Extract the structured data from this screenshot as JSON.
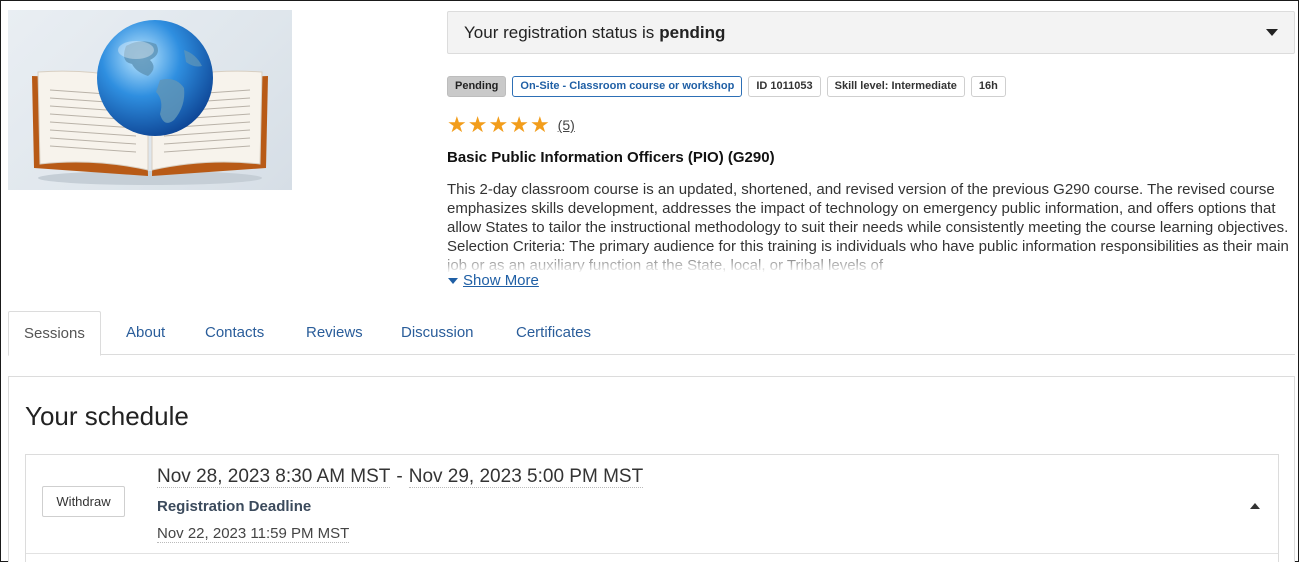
{
  "status": {
    "prefix": "Your registration status is",
    "value": "pending"
  },
  "badges": [
    "Pending",
    "On-Site - Classroom course or workshop",
    "ID 1011053",
    "Skill level: Intermediate",
    "16h"
  ],
  "rating": {
    "stars": 5,
    "count": "(5)"
  },
  "course": {
    "title": "Basic Public Information Officers (PIO) (G290)",
    "description": "This 2-day classroom course is an updated, shortened, and revised version of the previous G290 course. The revised course emphasizes skills development, addresses the impact of technology on emergency public information, and offers options that allow States to tailor the instructional methodology to suit their needs while consistently meeting the course learning objectives. Selection Criteria: The primary audience for this training is individuals who have public information responsibilities as their main job or as an auxiliary function at the State, local, or Tribal levels of",
    "show_more": "Show More"
  },
  "tabs": [
    "Sessions",
    "About",
    "Contacts",
    "Reviews",
    "Discussion",
    "Certificates"
  ],
  "schedule": {
    "title": "Your schedule",
    "session": {
      "withdraw": "Withdraw",
      "start": "Nov 28, 2023 8:30 AM MST",
      "separator": "-",
      "end": "Nov 29, 2023 5:00 PM MST",
      "deadline_label": "Registration Deadline",
      "deadline_value": "Nov 22, 2023 11:59 PM MST"
    }
  },
  "icons": {
    "status_dropdown": "caret-down-icon",
    "show_more": "caret-down-icon",
    "session_toggle": "caret-up-icon",
    "star": "star-icon"
  },
  "colors": {
    "link": "#1f5fa5",
    "star": "#f29d1b",
    "status_bg": "#f3f3f3",
    "pending_badge": "#c9c9c9",
    "onsite_badge_border": "#2d6fb5"
  }
}
